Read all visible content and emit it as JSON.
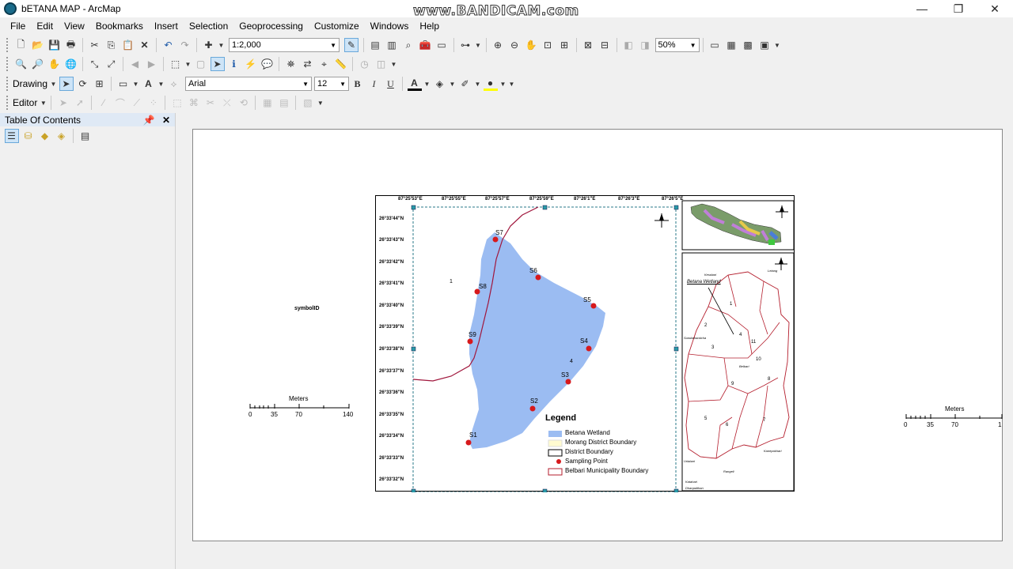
{
  "window": {
    "title": "bETANA MAP - ArcMap"
  },
  "watermark": "www.BANDICAM.com",
  "menu": [
    "File",
    "Edit",
    "View",
    "Bookmarks",
    "Insert",
    "Selection",
    "Geoprocessing",
    "Customize",
    "Windows",
    "Help"
  ],
  "toolbar": {
    "scale": "1:2,000",
    "zoom": "50%"
  },
  "drawing": {
    "label": "Drawing",
    "font": "Arial",
    "size": "12",
    "bold": "B",
    "italic": "I",
    "underline": "U",
    "font_color": "A"
  },
  "editor": {
    "label": "Editor"
  },
  "toc": {
    "title": "Table Of Contents"
  },
  "layout": {
    "symbol_label": "symbolID",
    "scalebar_left": {
      "title": "Meters",
      "ticks": [
        "0",
        "35",
        "70",
        "140"
      ]
    },
    "scalebar_right": {
      "title": "Meters",
      "ticks": [
        "0",
        "35",
        "70",
        "1"
      ]
    }
  },
  "map": {
    "top_labels": [
      "87°25'53\"E",
      "87°25'55\"E",
      "87°25'57\"E",
      "87°25'59\"E",
      "87°26'1\"E",
      "87°26'3\"E",
      "87°26'5\"E"
    ],
    "left_labels": [
      "26°33'44\"N",
      "26°33'43\"N",
      "26°33'42\"N",
      "26°33'41\"N",
      "26°33'40\"N",
      "26°33'39\"N",
      "26°33'38\"N",
      "26°33'37\"N",
      "26°33'36\"N",
      "26°33'35\"N",
      "26°33'34\"N",
      "26°33'33\"N",
      "26°33'32\"N"
    ],
    "wetland_number": "4",
    "stray_label": "1",
    "points": [
      "S1",
      "S2",
      "S3",
      "S4",
      "S5",
      "S6",
      "S7",
      "S8",
      "S9"
    ],
    "legend": {
      "title": "Legend",
      "items": [
        "Betana Wetland",
        "Morang District Boundary",
        "District Boundary",
        "Sampling Point",
        "Belbari Municipality Boundary"
      ]
    },
    "inset_municipal": {
      "annotation": "Betana Wetland",
      "ward_numbers": [
        "1",
        "2",
        "3",
        "4",
        "5",
        "6",
        "7",
        "8",
        "9",
        "10",
        "11"
      ],
      "place_names": [
        "Kerabari",
        "Letang",
        "Sundarharaicha",
        "Belbari",
        "Urlabari",
        "Kanepokhari",
        "Rangeli",
        "Dhanpalthan",
        "Katahari"
      ]
    }
  },
  "colors": {
    "wetland": "#9bbcf2",
    "sampling_point": "#d7191c",
    "municipality_boundary": "#b41e2d",
    "district_boundary": "#a0163c"
  }
}
